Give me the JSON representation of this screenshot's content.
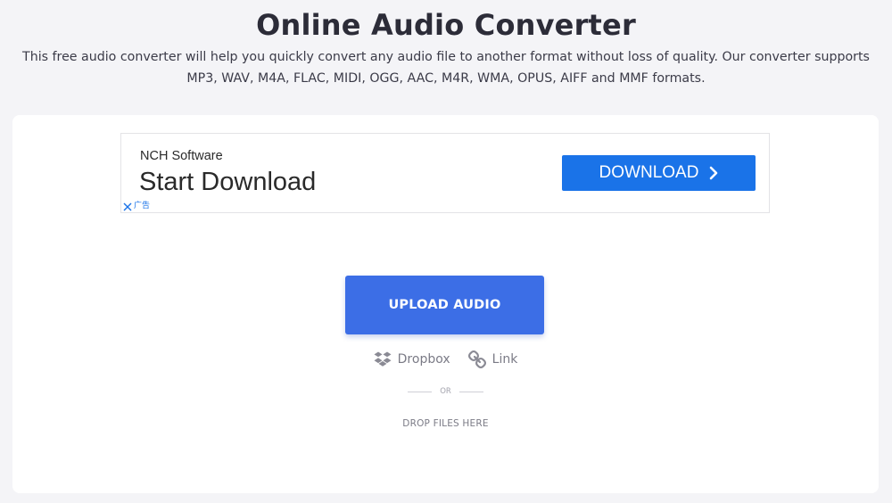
{
  "header": {
    "title": "Online Audio Converter",
    "description": "This free audio converter will help you quickly convert any audio file to another format without loss of quality. Our converter supports MP3, WAV, M4A, FLAC, MIDI, OGG, AAC, M4R, WMA, OPUS, AIFF and MMF formats."
  },
  "ad": {
    "brand": "NCH Software",
    "headline": "Start Download",
    "cta_label": "DOWNLOAD",
    "choices_label": "广告",
    "cta_color": "#1a73e8"
  },
  "upload": {
    "button_label": "UPLOAD AUDIO",
    "button_color": "#3c6ee6",
    "sources": [
      {
        "icon": "dropbox-icon",
        "label": "Dropbox"
      },
      {
        "icon": "link-icon",
        "label": "Link"
      }
    ],
    "or_label": "OR",
    "drop_label": "DROP FILES HERE"
  }
}
